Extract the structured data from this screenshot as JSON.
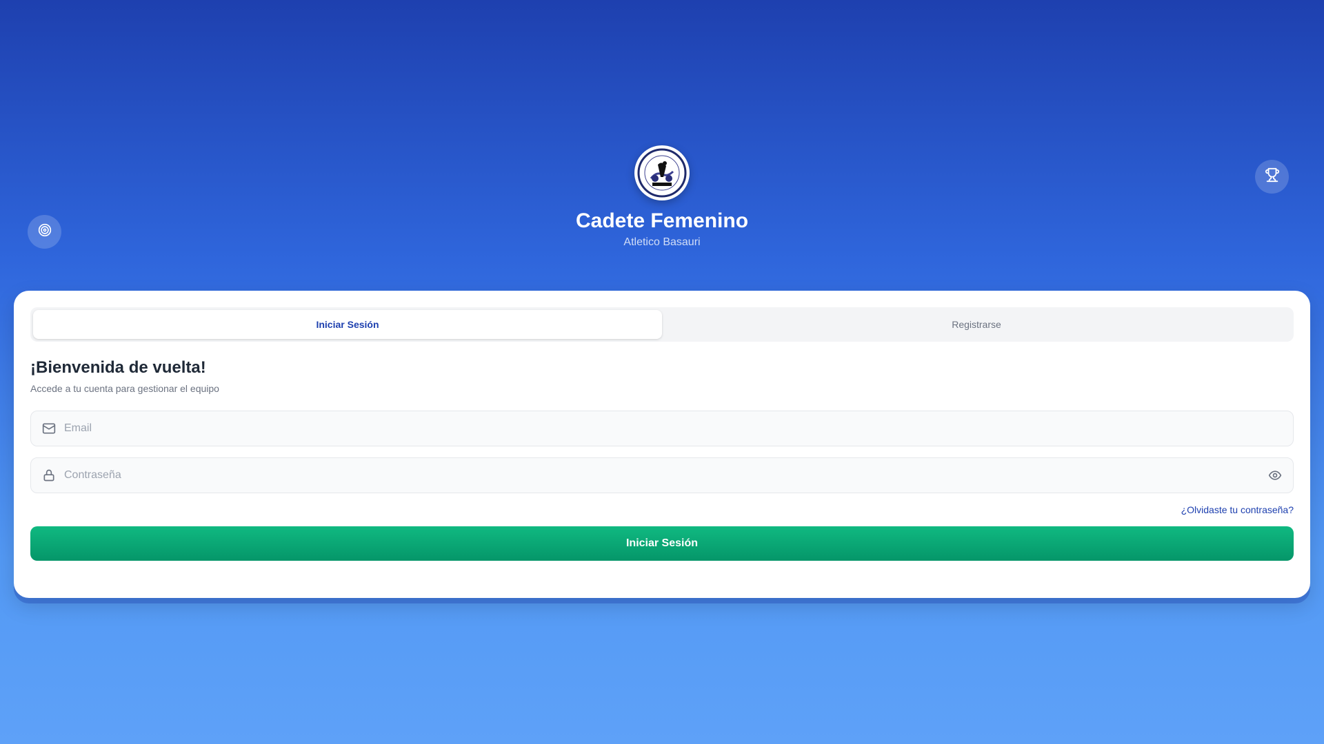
{
  "header": {
    "title": "Cadete Femenino",
    "subtitle": "Atletico Basauri",
    "logo_text": "ATLETICO BASAURI BALONMANO CLUB"
  },
  "floating": {
    "left_icon": "target-icon",
    "right_icon": "trophy-icon"
  },
  "tabs": [
    {
      "label": "Iniciar Sesión",
      "active": true
    },
    {
      "label": "Registrarse",
      "active": false
    }
  ],
  "form": {
    "heading": "¡Bienvenida de vuelta!",
    "subheading": "Accede a tu cuenta para gestionar el equipo",
    "email": {
      "value": "",
      "placeholder": "Email",
      "icon": "mail-icon"
    },
    "password": {
      "value": "",
      "placeholder": "Contraseña",
      "icon": "lock-icon",
      "toggle_icon": "eye-icon"
    },
    "forgot_link": "¿Olvidaste tu contraseña?",
    "submit_label": "Iniciar Sesión"
  },
  "colors": {
    "primary": "#1e40af",
    "success": "#10b981",
    "background_top": "#1e40af",
    "background_bottom": "#5ea1f8"
  }
}
